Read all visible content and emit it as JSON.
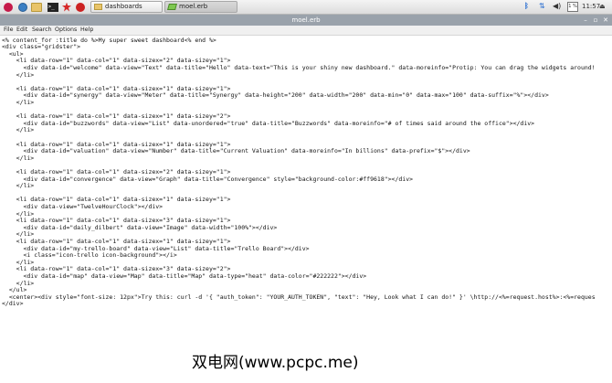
{
  "taskbar": {
    "launchers": [
      "raspberry-menu-icon",
      "web-browser-icon",
      "file-manager-icon",
      "terminal-icon",
      "mathematica-icon",
      "wolfram-icon"
    ],
    "tasks": [
      {
        "label": "dashboards",
        "icon": "folder-icon",
        "active": false
      },
      {
        "label": "moel.erb",
        "icon": "text-editor-icon",
        "active": true
      }
    ],
    "tray": {
      "bluetooth_glyph": "ᛒ",
      "wifi_glyph": "⇅",
      "volume_glyph": "◀)",
      "cpu_label": "1 %",
      "time": "11:57",
      "eject_glyph": "⏏"
    }
  },
  "window": {
    "title": "moel.erb",
    "minimize_glyph": "–",
    "maximize_glyph": "▫",
    "close_glyph": "✕"
  },
  "menu": {
    "file": "File",
    "edit": "Edit",
    "search": "Search",
    "options": "Options",
    "help": "Help"
  },
  "editor": {
    "lines": [
      "<% content_for :title do %>My super sweet dashboard<% end %>",
      "<div class=\"gridster\">",
      "  <ul>",
      "    <li data-row=\"1\" data-col=\"1\" data-sizex=\"2\" data-sizey=\"1\">",
      "      <div data-id=\"welcome\" data-view=\"Text\" data-title=\"Hello\" data-text=\"This is your shiny new dashboard.\" data-moreinfo=\"Protip: You can drag the widgets around!",
      "    </li>",
      "",
      "    <li data-row=\"1\" data-col=\"1\" data-sizex=\"1\" data-sizey=\"1\">",
      "      <div data-id=\"synergy\" data-view=\"Meter\" data-title=\"Synergy\" data-height=\"200\" data-width=\"200\" data-min=\"0\" data-max=\"100\" data-suffix=\"%\"></div>",
      "    </li>",
      "",
      "    <li data-row=\"1\" data-col=\"1\" data-sizex=\"1\" data-sizey=\"2\">",
      "      <div data-id=\"buzzwords\" data-view=\"List\" data-unordered=\"true\" data-title=\"Buzzwords\" data-moreinfo=\"# of times said around the office\"></div>",
      "    </li>",
      "",
      "    <li data-row=\"1\" data-col=\"1\" data-sizex=\"1\" data-sizey=\"1\">",
      "      <div data-id=\"valuation\" data-view=\"Number\" data-title=\"Current Valuation\" data-moreinfo=\"In billions\" data-prefix=\"$\"></div>",
      "    </li>",
      "",
      "    <li data-row=\"1\" data-col=\"1\" data-sizex=\"2\" data-sizey=\"1\">",
      "      <div data-id=\"convergence\" data-view=\"Graph\" data-title=\"Convergence\" style=\"background-color:#ff9618\"></div>",
      "    </li>",
      "",
      "    <li data-row=\"1\" data-col=\"1\" data-sizex=\"1\" data-sizey=\"1\">",
      "      <div data-view=\"TwelveHourClock\"></div>",
      "    </li>",
      "    <li data-row=\"1\" data-col=\"1\" data-sizex=\"3\" data-sizey=\"1\">",
      "      <div data-id=\"daily_dilbert\" data-view=\"Image\" data-width=\"100%\"></div>",
      "    </li>",
      "    <li data-row=\"1\" data-col=\"1\" data-sizex=\"1\" data-sizey=\"1\">",
      "      <div data-id=\"my-trello-board\" data-view=\"List\" data-title=\"Trello Board\"></div>",
      "      <i class=\"icon-trello icon-background\"></i>",
      "    </li>",
      "    <li data-row=\"1\" data-col=\"1\" data-sizex=\"3\" data-sizey=\"2\">",
      "      <div data-id=\"map\" data-view=\"Map\" data-title=\"Map\" data-type=\"heat\" data-color=\"#222222\"></div>",
      "    </li>",
      "  </ul>",
      "  <center><div style=\"font-size: 12px\">Try this: curl -d '{ \"auth_token\": \"YOUR_AUTH_TOKEN\", \"text\": \"Hey, Look what I can do!\" }' \\http://<%=request.host%>:<%=reques",
      "</div>"
    ]
  },
  "watermark": "双电网(www.pcpc.me)"
}
